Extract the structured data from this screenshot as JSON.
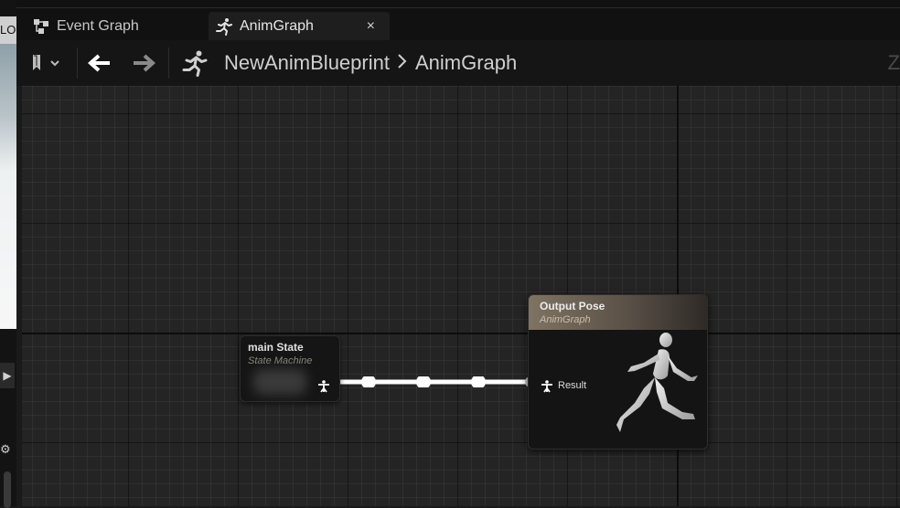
{
  "left_strip": {
    "lod_text": "LOD"
  },
  "tabs": [
    {
      "label": "Event Graph",
      "icon": "event-graph-icon",
      "active": false
    },
    {
      "label": "AnimGraph",
      "icon": "running-man-icon",
      "active": true,
      "close": "×"
    }
  ],
  "toolbar": {
    "bookmark_icon": "bookmark-icon",
    "back_icon": "arrow-left-icon",
    "forward_icon": "arrow-right-icon",
    "blueprint_icon": "running-man-icon",
    "breadcrumb": [
      "NewAnimBlueprint",
      "AnimGraph"
    ],
    "zoom_text": "Z"
  },
  "nodes": {
    "state_machine": {
      "title": "main State",
      "subtitle": "State Machine"
    },
    "output_pose": {
      "title": "Output Pose",
      "subtitle": "AnimGraph",
      "pin_label": "Result"
    }
  },
  "colors": {
    "graph_bg": "#242424",
    "output_header": "#7f7362",
    "wire": "#ffffff"
  }
}
